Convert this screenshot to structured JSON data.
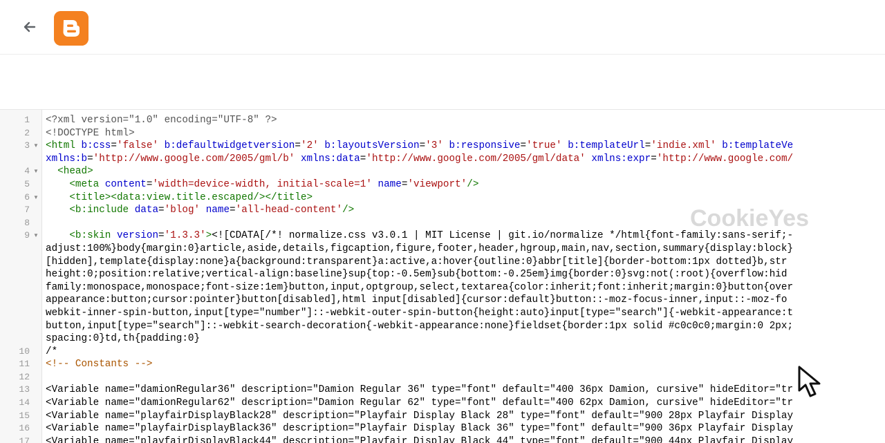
{
  "header": {
    "back_label": "Back",
    "logo_icon": "blogger-logo-icon",
    "logo_color": "#f48120"
  },
  "watermark": "CookieYes",
  "code_lines": [
    {
      "num": "1",
      "fold": false,
      "tokens": [
        {
          "t": "pi",
          "v": "<?xml version=\"1.0\" encoding=\"UTF-8\" ?>"
        }
      ]
    },
    {
      "num": "2",
      "fold": false,
      "tokens": [
        {
          "t": "pi",
          "v": "<!DOCTYPE html>"
        }
      ]
    },
    {
      "num": "3",
      "fold": true,
      "tokens": [
        {
          "t": "tag",
          "v": "<html "
        },
        {
          "t": "attr",
          "v": "b:css"
        },
        {
          "t": "plain",
          "v": "="
        },
        {
          "t": "str",
          "v": "'false'"
        },
        {
          "t": "plain",
          "v": " "
        },
        {
          "t": "attr",
          "v": "b:defaultwidgetversion"
        },
        {
          "t": "plain",
          "v": "="
        },
        {
          "t": "str",
          "v": "'2'"
        },
        {
          "t": "plain",
          "v": " "
        },
        {
          "t": "attr",
          "v": "b:layoutsVersion"
        },
        {
          "t": "plain",
          "v": "="
        },
        {
          "t": "str",
          "v": "'3'"
        },
        {
          "t": "plain",
          "v": " "
        },
        {
          "t": "attr",
          "v": "b:responsive"
        },
        {
          "t": "plain",
          "v": "="
        },
        {
          "t": "str",
          "v": "'true'"
        },
        {
          "t": "plain",
          "v": " "
        },
        {
          "t": "attr",
          "v": "b:templateUrl"
        },
        {
          "t": "plain",
          "v": "="
        },
        {
          "t": "str",
          "v": "'indie.xml'"
        },
        {
          "t": "plain",
          "v": " "
        },
        {
          "t": "attr",
          "v": "b:templateVe"
        }
      ]
    },
    {
      "num": "",
      "fold": false,
      "tokens": [
        {
          "t": "attr",
          "v": "xmlns:b"
        },
        {
          "t": "plain",
          "v": "="
        },
        {
          "t": "str",
          "v": "'http://www.google.com/2005/gml/b'"
        },
        {
          "t": "plain",
          "v": " "
        },
        {
          "t": "attr",
          "v": "xmlns:data"
        },
        {
          "t": "plain",
          "v": "="
        },
        {
          "t": "str",
          "v": "'http://www.google.com/2005/gml/data'"
        },
        {
          "t": "plain",
          "v": " "
        },
        {
          "t": "attr",
          "v": "xmlns:expr"
        },
        {
          "t": "plain",
          "v": "="
        },
        {
          "t": "str",
          "v": "'http://www.google.com/"
        }
      ]
    },
    {
      "num": "4",
      "fold": true,
      "tokens": [
        {
          "t": "plain",
          "v": "  "
        },
        {
          "t": "tag",
          "v": "<head>"
        }
      ]
    },
    {
      "num": "5",
      "fold": false,
      "tokens": [
        {
          "t": "plain",
          "v": "    "
        },
        {
          "t": "tag",
          "v": "<meta "
        },
        {
          "t": "attr",
          "v": "content"
        },
        {
          "t": "plain",
          "v": "="
        },
        {
          "t": "str",
          "v": "'width=device-width, initial-scale=1'"
        },
        {
          "t": "plain",
          "v": " "
        },
        {
          "t": "attr",
          "v": "name"
        },
        {
          "t": "plain",
          "v": "="
        },
        {
          "t": "str",
          "v": "'viewport'"
        },
        {
          "t": "tag",
          "v": "/>"
        }
      ]
    },
    {
      "num": "6",
      "fold": true,
      "tokens": [
        {
          "t": "plain",
          "v": "    "
        },
        {
          "t": "tag",
          "v": "<title><data:view.title.escaped/></title>"
        }
      ]
    },
    {
      "num": "7",
      "fold": false,
      "tokens": [
        {
          "t": "plain",
          "v": "    "
        },
        {
          "t": "tag",
          "v": "<b:include "
        },
        {
          "t": "attr",
          "v": "data"
        },
        {
          "t": "plain",
          "v": "="
        },
        {
          "t": "str",
          "v": "'blog'"
        },
        {
          "t": "plain",
          "v": " "
        },
        {
          "t": "attr",
          "v": "name"
        },
        {
          "t": "plain",
          "v": "="
        },
        {
          "t": "str",
          "v": "'all-head-content'"
        },
        {
          "t": "tag",
          "v": "/>"
        }
      ]
    },
    {
      "num": "8",
      "fold": false,
      "tokens": []
    },
    {
      "num": "9",
      "fold": true,
      "tokens": [
        {
          "t": "plain",
          "v": "    "
        },
        {
          "t": "tag",
          "v": "<b:skin "
        },
        {
          "t": "attr",
          "v": "version"
        },
        {
          "t": "plain",
          "v": "="
        },
        {
          "t": "str",
          "v": "'1.3.3'"
        },
        {
          "t": "tag",
          "v": ">"
        },
        {
          "t": "plain",
          "v": "<![CDATA[/*! normalize.css v3.0.1 | MIT License | git.io/normalize */html{font-family:sans-serif;-"
        }
      ]
    },
    {
      "num": "",
      "fold": false,
      "tokens": [
        {
          "t": "plain",
          "v": "adjust:100%}body{margin:0}article,aside,details,figcaption,figure,footer,header,hgroup,main,nav,section,summary{display:block}"
        }
      ]
    },
    {
      "num": "",
      "fold": false,
      "tokens": [
        {
          "t": "plain",
          "v": "[hidden],template{display:none}a{background:transparent}a:active,a:hover{outline:0}abbr[title]{border-bottom:1px dotted}b,str"
        }
      ]
    },
    {
      "num": "",
      "fold": false,
      "tokens": [
        {
          "t": "plain",
          "v": "height:0;position:relative;vertical-align:baseline}sup{top:-0.5em}sub{bottom:-0.25em}img{border:0}svg:not(:root){overflow:hid"
        }
      ]
    },
    {
      "num": "",
      "fold": false,
      "tokens": [
        {
          "t": "plain",
          "v": "family:monospace,monospace;font-size:1em}button,input,optgroup,select,textarea{color:inherit;font:inherit;margin:0}button{over"
        }
      ]
    },
    {
      "num": "",
      "fold": false,
      "tokens": [
        {
          "t": "plain",
          "v": "appearance:button;cursor:pointer}button[disabled],html input[disabled]{cursor:default}button::-moz-focus-inner,input::-moz-fo"
        }
      ]
    },
    {
      "num": "",
      "fold": false,
      "tokens": [
        {
          "t": "plain",
          "v": "webkit-inner-spin-button,input[type=\"number\"]::-webkit-outer-spin-button{height:auto}input[type=\"search\"]{-webkit-appearance:t"
        }
      ]
    },
    {
      "num": "",
      "fold": false,
      "tokens": [
        {
          "t": "plain",
          "v": "button,input[type=\"search\"]::-webkit-search-decoration{-webkit-appearance:none}fieldset{border:1px solid #c0c0c0;margin:0 2px;"
        }
      ]
    },
    {
      "num": "",
      "fold": false,
      "tokens": [
        {
          "t": "plain",
          "v": "spacing:0}td,th{padding:0}"
        }
      ]
    },
    {
      "num": "10",
      "fold": false,
      "tokens": [
        {
          "t": "plain",
          "v": "/*"
        }
      ]
    },
    {
      "num": "11",
      "fold": false,
      "tokens": [
        {
          "t": "com",
          "v": "<!-- Constants -->"
        }
      ]
    },
    {
      "num": "12",
      "fold": false,
      "tokens": []
    },
    {
      "num": "13",
      "fold": false,
      "tokens": [
        {
          "t": "plain",
          "v": "<Variable name=\"damionRegular36\" description=\"Damion Regular 36\" type=\"font\" default=\"400 36px Damion, cursive\" hideEditor=\"tr"
        }
      ]
    },
    {
      "num": "14",
      "fold": false,
      "tokens": [
        {
          "t": "plain",
          "v": "<Variable name=\"damionRegular62\" description=\"Damion Regular 62\" type=\"font\" default=\"400 62px Damion, cursive\" hideEditor=\"tr"
        }
      ]
    },
    {
      "num": "15",
      "fold": false,
      "tokens": [
        {
          "t": "plain",
          "v": "<Variable name=\"playfairDisplayBlack28\" description=\"Playfair Display Black 28\" type=\"font\" default=\"900 28px Playfair Display"
        }
      ]
    },
    {
      "num": "16",
      "fold": false,
      "tokens": [
        {
          "t": "plain",
          "v": "<Variable name=\"playfairDisplayBlack36\" description=\"Playfair Display Black 36\" type=\"font\" default=\"900 36px Playfair Display"
        }
      ]
    },
    {
      "num": "17",
      "fold": false,
      "tokens": [
        {
          "t": "plain",
          "v": "<Variable name=\"playfairDisplayBlack44\" description=\"Playfair Display Black 44\" type=\"font\" default=\"900 44px Playfair Display"
        }
      ]
    }
  ]
}
